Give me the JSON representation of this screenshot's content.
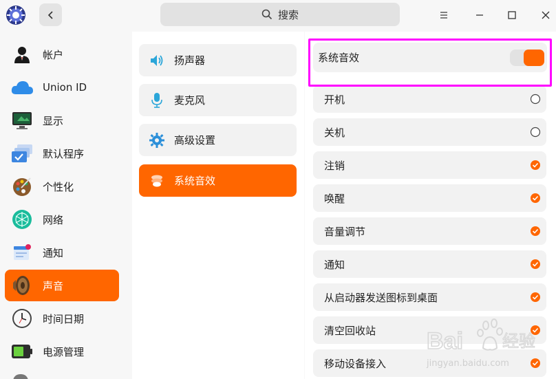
{
  "header": {
    "search_label": "搜索"
  },
  "sidebar": {
    "items": [
      {
        "label": "帐户",
        "icon": "account-icon"
      },
      {
        "label": "Union ID",
        "icon": "cloud-icon"
      },
      {
        "label": "显示",
        "icon": "display-icon"
      },
      {
        "label": "默认程序",
        "icon": "default-apps-icon"
      },
      {
        "label": "个性化",
        "icon": "palette-icon"
      },
      {
        "label": "网络",
        "icon": "network-icon"
      },
      {
        "label": "通知",
        "icon": "notification-icon"
      },
      {
        "label": "声音",
        "icon": "speaker-icon",
        "active": true
      },
      {
        "label": "时间日期",
        "icon": "clock-icon"
      },
      {
        "label": "电源管理",
        "icon": "battery-icon"
      }
    ]
  },
  "sound_nav": {
    "items": [
      {
        "label": "扬声器",
        "icon": "speaker-output-icon"
      },
      {
        "label": "麦克风",
        "icon": "microphone-icon"
      },
      {
        "label": "高级设置",
        "icon": "gear-icon"
      },
      {
        "label": "系统音效",
        "icon": "sound-effects-icon",
        "active": true
      }
    ]
  },
  "effects": {
    "master_label": "系统音效",
    "master_enabled": true,
    "items": [
      {
        "label": "开机",
        "checked": false
      },
      {
        "label": "关机",
        "checked": false
      },
      {
        "label": "注销",
        "checked": true
      },
      {
        "label": "唤醒",
        "checked": true
      },
      {
        "label": "音量调节",
        "checked": true
      },
      {
        "label": "通知",
        "checked": true
      },
      {
        "label": "从启动器发送图标到桌面",
        "checked": true
      },
      {
        "label": "清空回收站",
        "checked": true
      },
      {
        "label": "移动设备接入",
        "checked": true
      }
    ]
  },
  "watermark": {
    "brand": "Bai",
    "brand_suffix": "经验",
    "url": "jingyan.baidu.com"
  },
  "colors": {
    "accent": "#ff6600",
    "highlight": "#ff00ff"
  }
}
